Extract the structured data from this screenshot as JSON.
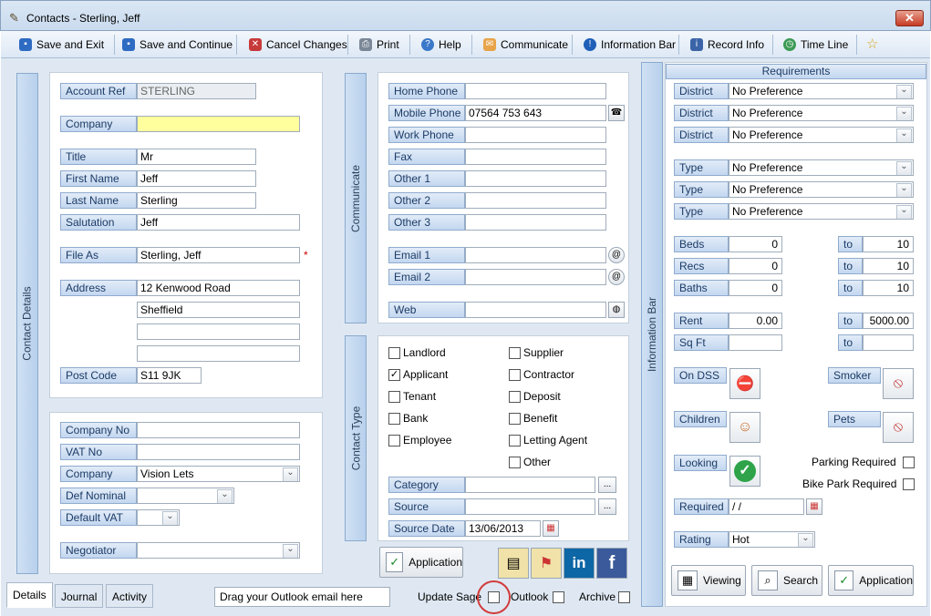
{
  "window": {
    "title": "Contacts  -  Sterling, Jeff",
    "close": "✕"
  },
  "toolbar": {
    "save_exit": "Save and Exit",
    "save_continue": "Save and Continue",
    "cancel": "Cancel Changes",
    "print": "Print",
    "help": "Help",
    "communicate": "Communicate",
    "info_bar": "Information Bar",
    "record_info": "Record Info",
    "time_line": "Time Line"
  },
  "side_tabs": {
    "contact_details": "Contact Details",
    "communicate": "Communicate",
    "contact_type": "Contact Type",
    "information_bar": "Information Bar"
  },
  "details": {
    "account_ref_label": "Account Ref",
    "account_ref": "STERLING",
    "company_label": "Company",
    "company": "",
    "title_label": "Title",
    "title": "Mr",
    "first_name_label": "First Name",
    "first_name": "Jeff",
    "last_name_label": "Last Name",
    "last_name": "Sterling",
    "salutation_label": "Salutation",
    "salutation": "Jeff",
    "file_as_label": "File As",
    "file_as": "Sterling, Jeff",
    "required_mark": "*",
    "address_label": "Address",
    "address1": "12 Kenwood Road",
    "address2": "Sheffield",
    "address3": "",
    "address4": "",
    "postcode_label": "Post Code",
    "postcode": "S11 9JK"
  },
  "company_info": {
    "company_no_label": "Company No",
    "company_no": "",
    "vat_no_label": "VAT No",
    "vat_no": "",
    "company_label": "Company",
    "company": "Vision Lets",
    "def_nominal_label": "Def Nominal",
    "def_nominal": "",
    "default_vat_label": "Default VAT",
    "default_vat": "",
    "negotiator_label": "Negotiator",
    "negotiator": ""
  },
  "communicate": {
    "home_phone_label": "Home Phone",
    "home_phone": "",
    "mobile_phone_label": "Mobile Phone",
    "mobile_phone": "07564 753 643",
    "work_phone_label": "Work Phone",
    "work_phone": "",
    "fax_label": "Fax",
    "fax": "",
    "other1_label": "Other 1",
    "other1": "",
    "other2_label": "Other 2",
    "other2": "",
    "other3_label": "Other 3",
    "other3": "",
    "email1_label": "Email 1",
    "email1": "",
    "email2_label": "Email 2",
    "email2": "",
    "web_label": "Web",
    "web": ""
  },
  "contact_type": {
    "landlord": "Landlord",
    "applicant": "Applicant",
    "tenant": "Tenant",
    "bank": "Bank",
    "employee": "Employee",
    "supplier": "Supplier",
    "contractor": "Contractor",
    "deposit": "Deposit",
    "benefit": "Benefit",
    "letting_agent": "Letting Agent",
    "other": "Other",
    "applicant_checked": true,
    "category_label": "Category",
    "category": "",
    "source_label": "Source",
    "source": "",
    "source_date_label": "Source Date",
    "source_date": "13/06/2013",
    "application_btn": "Application",
    "ellipsis": "..."
  },
  "requirements": {
    "header": "Requirements",
    "district_label": "District",
    "type_label": "Type",
    "no_pref": "No Preference",
    "beds_label": "Beds",
    "beds_from": "0",
    "beds_to": "10",
    "recs_label": "Recs",
    "recs_from": "0",
    "recs_to": "10",
    "baths_label": "Baths",
    "baths_from": "0",
    "baths_to": "10",
    "rent_label": "Rent",
    "rent_from": "0.00",
    "rent_to": "5000.00",
    "sqft_label": "Sq Ft",
    "sqft_from": "",
    "sqft_to": "",
    "to_label": "to",
    "on_dss_label": "On DSS",
    "smoker_label": "Smoker",
    "children_label": "Children",
    "pets_label": "Pets",
    "looking_label": "Looking",
    "parking_label": "Parking Required",
    "bike_label": "Bike Park Required",
    "required_label": "Required",
    "required_value": " / /",
    "rating_label": "Rating",
    "rating": "Hot",
    "viewing_btn": "Viewing",
    "search_btn": "Search",
    "application_btn": "Application"
  },
  "bottom": {
    "tab_details": "Details",
    "tab_journal": "Journal",
    "tab_activity": "Activity",
    "outlook_drop": "Drag your Outlook email here",
    "update_sage": "Update Sage",
    "outlook": "Outlook",
    "archive": "Archive"
  }
}
